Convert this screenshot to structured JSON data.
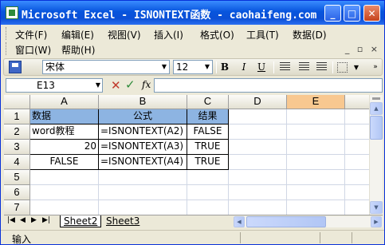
{
  "window": {
    "title": "Microsoft Excel - ISNONTEXT函数 - caohaifeng.com",
    "min_symbol": "_",
    "max_symbol": "□",
    "close_symbol": "✕"
  },
  "menu": {
    "row1": [
      "文件(F)",
      "编辑(E)",
      "视图(V)",
      "插入(I)",
      "格式(O)",
      "工具(T)",
      "数据(D)"
    ],
    "row2": [
      "窗口(W)",
      "帮助(H)"
    ],
    "doc_controls": [
      "_",
      "▫",
      "×"
    ]
  },
  "toolbar": {
    "font_name": "宋体",
    "font_size": "12",
    "bold": "B",
    "italic": "I",
    "underline": "U"
  },
  "formula_bar": {
    "name_box": "E13",
    "cancel": "✕",
    "enter": "✓",
    "fx": "fx",
    "content": ""
  },
  "grid": {
    "columns": [
      "A",
      "B",
      "C",
      "D",
      "E"
    ],
    "selected_column": "E",
    "rows": [
      "1",
      "2",
      "3",
      "4",
      "5",
      "6",
      "7"
    ],
    "cells": {
      "A1": "数据",
      "B1": "公式",
      "C1": "结果",
      "A2": "word教程",
      "B2": "=ISNONTEXT(A2)",
      "C2": "FALSE",
      "A3": "20",
      "B3": "=ISNONTEXT(A3)",
      "C3": "TRUE",
      "A4": "FALSE",
      "B4": "=ISNONTEXT(A4)",
      "C4": "TRUE"
    },
    "header_fill": "#8db4e2"
  },
  "sheets": {
    "nav": [
      "|◀",
      "◀",
      "▶",
      "▶|"
    ],
    "tabs": [
      "Sheet2",
      "Sheet3"
    ],
    "active": "Sheet2"
  },
  "status": {
    "mode": "输入"
  }
}
